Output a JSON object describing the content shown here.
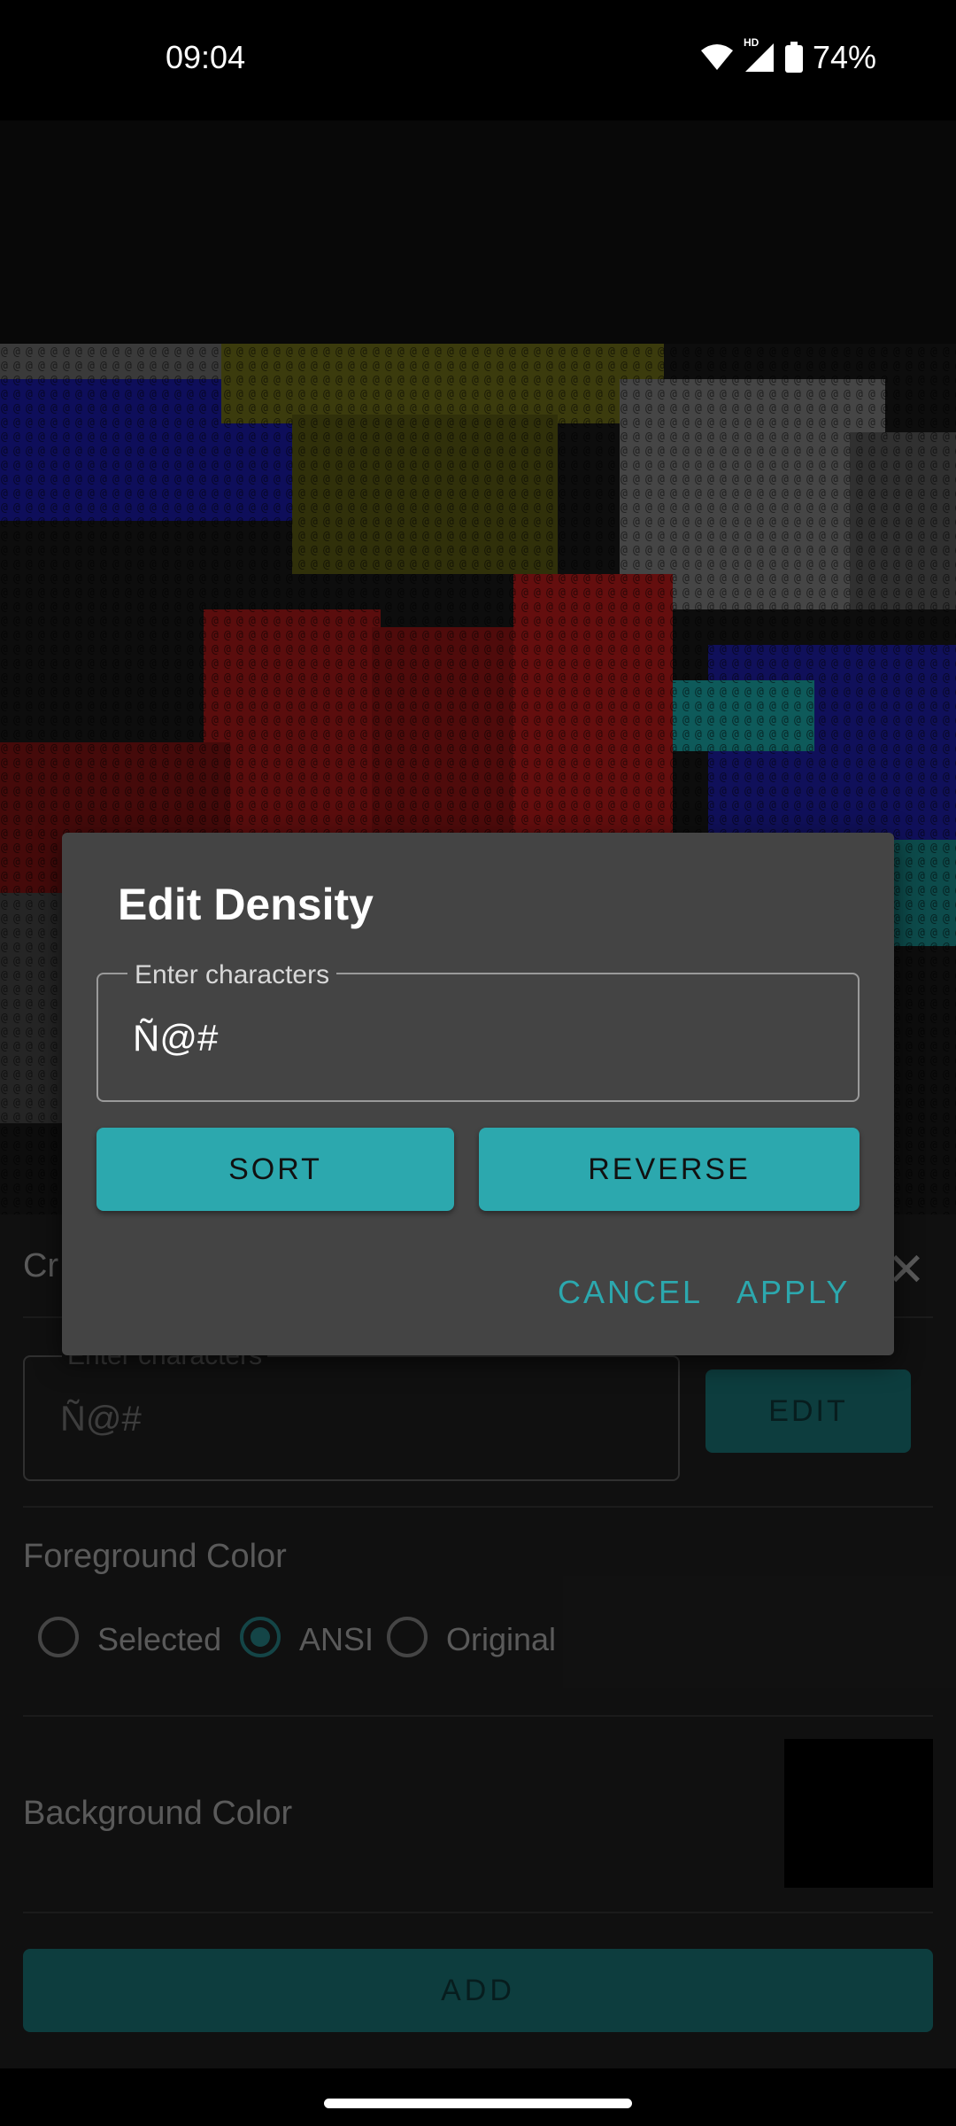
{
  "status_bar": {
    "time": "09:04",
    "battery": "74%",
    "network_badge": "HD"
  },
  "panel": {
    "title": "Cr",
    "density_field": {
      "label": "Enter characters",
      "value": "Ñ@#"
    },
    "edit_label": "EDIT",
    "foreground": {
      "label": "Foreground Color",
      "options": [
        "Selected",
        "ANSI",
        "Original"
      ],
      "selected": "ANSI"
    },
    "background_label": "Background Color",
    "background_color": "#000000",
    "add_label": "ADD"
  },
  "dialog": {
    "title": "Edit Density",
    "field_label": "Enter characters",
    "field_value": "Ñ@#",
    "sort_label": "SORT",
    "reverse_label": "REVERSE",
    "cancel_label": "CANCEL",
    "apply_label": "APPLY"
  },
  "colors": {
    "accent": "#2ca8ae",
    "accent_dim": "#145e60"
  }
}
